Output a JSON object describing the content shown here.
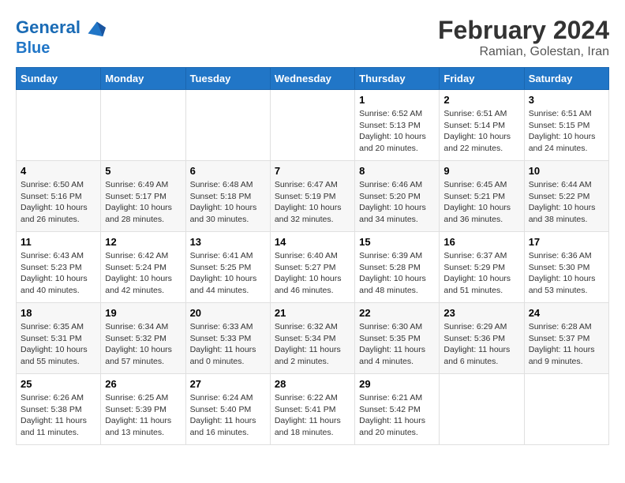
{
  "header": {
    "logo_line1": "General",
    "logo_line2": "Blue",
    "main_title": "February 2024",
    "sub_title": "Ramian, Golestan, Iran"
  },
  "days_of_week": [
    "Sunday",
    "Monday",
    "Tuesday",
    "Wednesday",
    "Thursday",
    "Friday",
    "Saturday"
  ],
  "weeks": [
    [
      {
        "day": "",
        "text": ""
      },
      {
        "day": "",
        "text": ""
      },
      {
        "day": "",
        "text": ""
      },
      {
        "day": "",
        "text": ""
      },
      {
        "day": "1",
        "text": "Sunrise: 6:52 AM\nSunset: 5:13 PM\nDaylight: 10 hours\nand 20 minutes."
      },
      {
        "day": "2",
        "text": "Sunrise: 6:51 AM\nSunset: 5:14 PM\nDaylight: 10 hours\nand 22 minutes."
      },
      {
        "day": "3",
        "text": "Sunrise: 6:51 AM\nSunset: 5:15 PM\nDaylight: 10 hours\nand 24 minutes."
      }
    ],
    [
      {
        "day": "4",
        "text": "Sunrise: 6:50 AM\nSunset: 5:16 PM\nDaylight: 10 hours\nand 26 minutes."
      },
      {
        "day": "5",
        "text": "Sunrise: 6:49 AM\nSunset: 5:17 PM\nDaylight: 10 hours\nand 28 minutes."
      },
      {
        "day": "6",
        "text": "Sunrise: 6:48 AM\nSunset: 5:18 PM\nDaylight: 10 hours\nand 30 minutes."
      },
      {
        "day": "7",
        "text": "Sunrise: 6:47 AM\nSunset: 5:19 PM\nDaylight: 10 hours\nand 32 minutes."
      },
      {
        "day": "8",
        "text": "Sunrise: 6:46 AM\nSunset: 5:20 PM\nDaylight: 10 hours\nand 34 minutes."
      },
      {
        "day": "9",
        "text": "Sunrise: 6:45 AM\nSunset: 5:21 PM\nDaylight: 10 hours\nand 36 minutes."
      },
      {
        "day": "10",
        "text": "Sunrise: 6:44 AM\nSunset: 5:22 PM\nDaylight: 10 hours\nand 38 minutes."
      }
    ],
    [
      {
        "day": "11",
        "text": "Sunrise: 6:43 AM\nSunset: 5:23 PM\nDaylight: 10 hours\nand 40 minutes."
      },
      {
        "day": "12",
        "text": "Sunrise: 6:42 AM\nSunset: 5:24 PM\nDaylight: 10 hours\nand 42 minutes."
      },
      {
        "day": "13",
        "text": "Sunrise: 6:41 AM\nSunset: 5:25 PM\nDaylight: 10 hours\nand 44 minutes."
      },
      {
        "day": "14",
        "text": "Sunrise: 6:40 AM\nSunset: 5:27 PM\nDaylight: 10 hours\nand 46 minutes."
      },
      {
        "day": "15",
        "text": "Sunrise: 6:39 AM\nSunset: 5:28 PM\nDaylight: 10 hours\nand 48 minutes."
      },
      {
        "day": "16",
        "text": "Sunrise: 6:37 AM\nSunset: 5:29 PM\nDaylight: 10 hours\nand 51 minutes."
      },
      {
        "day": "17",
        "text": "Sunrise: 6:36 AM\nSunset: 5:30 PM\nDaylight: 10 hours\nand 53 minutes."
      }
    ],
    [
      {
        "day": "18",
        "text": "Sunrise: 6:35 AM\nSunset: 5:31 PM\nDaylight: 10 hours\nand 55 minutes."
      },
      {
        "day": "19",
        "text": "Sunrise: 6:34 AM\nSunset: 5:32 PM\nDaylight: 10 hours\nand 57 minutes."
      },
      {
        "day": "20",
        "text": "Sunrise: 6:33 AM\nSunset: 5:33 PM\nDaylight: 11 hours\nand 0 minutes."
      },
      {
        "day": "21",
        "text": "Sunrise: 6:32 AM\nSunset: 5:34 PM\nDaylight: 11 hours\nand 2 minutes."
      },
      {
        "day": "22",
        "text": "Sunrise: 6:30 AM\nSunset: 5:35 PM\nDaylight: 11 hours\nand 4 minutes."
      },
      {
        "day": "23",
        "text": "Sunrise: 6:29 AM\nSunset: 5:36 PM\nDaylight: 11 hours\nand 6 minutes."
      },
      {
        "day": "24",
        "text": "Sunrise: 6:28 AM\nSunset: 5:37 PM\nDaylight: 11 hours\nand 9 minutes."
      }
    ],
    [
      {
        "day": "25",
        "text": "Sunrise: 6:26 AM\nSunset: 5:38 PM\nDaylight: 11 hours\nand 11 minutes."
      },
      {
        "day": "26",
        "text": "Sunrise: 6:25 AM\nSunset: 5:39 PM\nDaylight: 11 hours\nand 13 minutes."
      },
      {
        "day": "27",
        "text": "Sunrise: 6:24 AM\nSunset: 5:40 PM\nDaylight: 11 hours\nand 16 minutes."
      },
      {
        "day": "28",
        "text": "Sunrise: 6:22 AM\nSunset: 5:41 PM\nDaylight: 11 hours\nand 18 minutes."
      },
      {
        "day": "29",
        "text": "Sunrise: 6:21 AM\nSunset: 5:42 PM\nDaylight: 11 hours\nand 20 minutes."
      },
      {
        "day": "",
        "text": ""
      },
      {
        "day": "",
        "text": ""
      }
    ]
  ]
}
